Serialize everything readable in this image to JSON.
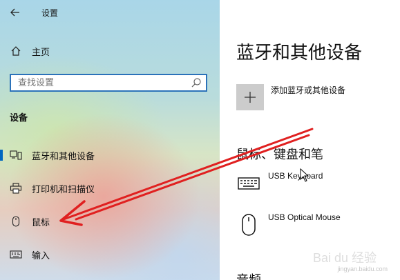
{
  "app": {
    "title": "设置"
  },
  "sidebar": {
    "home_label": "主页",
    "search": {
      "placeholder": "查找设置",
      "value": ""
    },
    "section_heading": "设备",
    "items": [
      {
        "label": "蓝牙和其他设备",
        "icon": "bluetooth-devices-icon",
        "selected": true
      },
      {
        "label": "打印机和扫描仪",
        "icon": "printer-icon",
        "selected": false
      },
      {
        "label": "鼠标",
        "icon": "mouse-icon",
        "selected": false
      },
      {
        "label": "输入",
        "icon": "keyboard-icon",
        "selected": false
      }
    ]
  },
  "main": {
    "title": "蓝牙和其他设备",
    "add_device_label": "添加蓝牙或其他设备",
    "devices_heading": "鼠标、键盘和笔",
    "devices": [
      {
        "name": "USB Keyboard",
        "icon": "keyboard-icon"
      },
      {
        "name": "USB Optical Mouse",
        "icon": "mouse-icon"
      }
    ],
    "audio_heading": "音频"
  },
  "annotation": {
    "arrow_color": "#e02020"
  },
  "watermark": {
    "brand": "Bai du 经验",
    "url": "jingyan.baidu.com"
  },
  "colors": {
    "accent": "#0067c0",
    "search_border": "#2b72b9",
    "tile": "#cccccc"
  }
}
